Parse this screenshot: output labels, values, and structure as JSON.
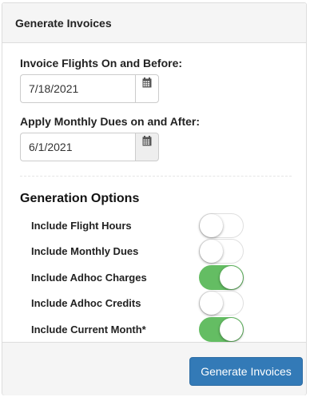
{
  "panel": {
    "title": "Generate Invoices"
  },
  "form": {
    "flights_before": {
      "label": "Invoice Flights On and Before:",
      "value": "7/18/2021"
    },
    "dues_after": {
      "label": "Apply Monthly Dues on and After:",
      "value": "6/1/2021"
    }
  },
  "options": {
    "title": "Generation Options",
    "items": [
      {
        "label": "Include Flight Hours",
        "checked": false
      },
      {
        "label": "Include Monthly Dues",
        "checked": false
      },
      {
        "label": "Include Adhoc Charges",
        "checked": true
      },
      {
        "label": "Include Adhoc Credits",
        "checked": false
      },
      {
        "label": "Include Current Month*",
        "checked": true
      }
    ]
  },
  "footer": {
    "generate_label": "Generate Invoices"
  },
  "colors": {
    "toggle_on": "#64bd63",
    "primary_button": "#337ab7"
  },
  "icons": {
    "calendar": "calendar-icon"
  }
}
